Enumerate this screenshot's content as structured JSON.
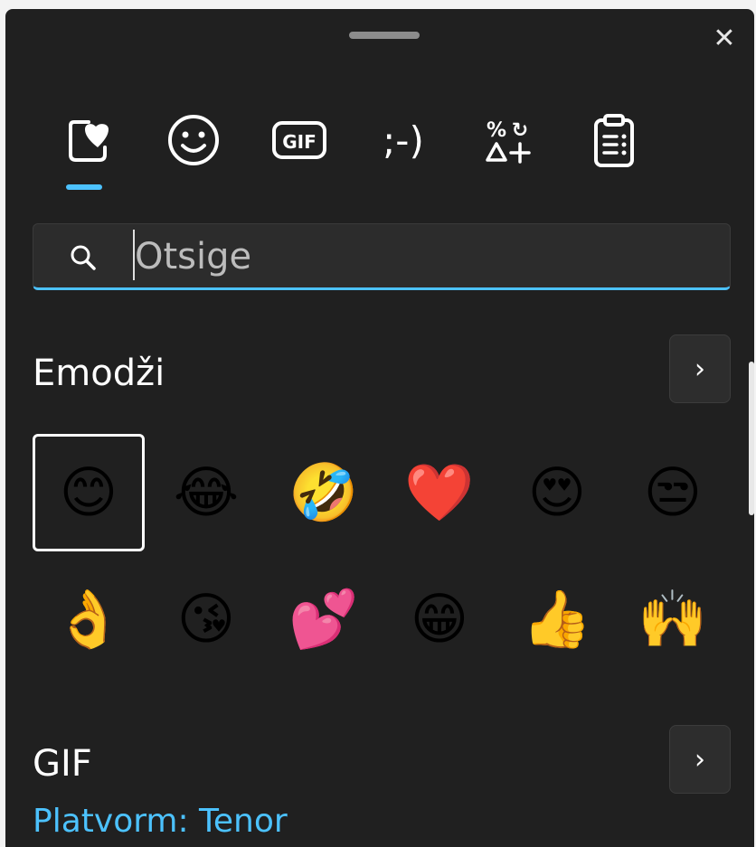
{
  "window": {
    "close_glyph": "✕"
  },
  "tabs": [
    {
      "name": "tab-favorites",
      "icon": "heart-in-box-icon"
    },
    {
      "name": "tab-emoji",
      "icon": "smiley-icon"
    },
    {
      "name": "tab-gif",
      "icon": "gif-icon",
      "label": "GIF"
    },
    {
      "name": "tab-kaomoji",
      "icon": "kaomoji-icon",
      "label": ";-)"
    },
    {
      "name": "tab-symbols",
      "icon": "symbols-icon"
    },
    {
      "name": "tab-clipboard",
      "icon": "clipboard-icon"
    }
  ],
  "search": {
    "placeholder": "Otsige"
  },
  "emoji_section": {
    "title": "Emodži",
    "more_glyph": "›",
    "items": [
      "😊",
      "😂",
      "🤣",
      "❤️",
      "😍",
      "😒",
      "👌",
      "😘",
      "💕",
      "😁",
      "👍",
      "🙌"
    ]
  },
  "gif_section": {
    "title": "GIF",
    "more_glyph": "›",
    "subtitle": "Platvorm: Tenor"
  },
  "colors": {
    "background": "#202020",
    "accent": "#4cc2ff",
    "text": "#ffffff"
  }
}
